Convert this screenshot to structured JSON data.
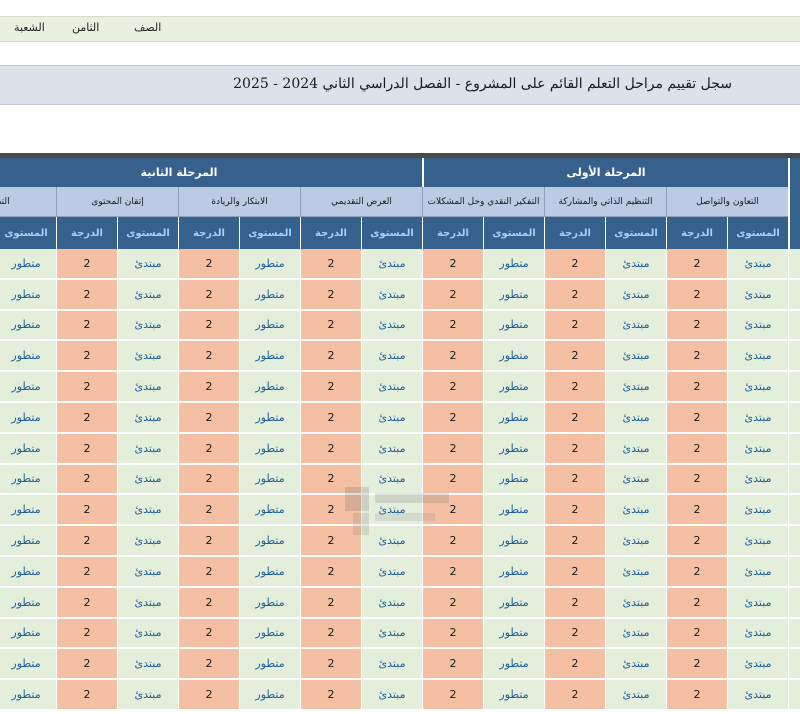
{
  "header": {
    "division_label": "الشعبة",
    "grade_value": "الثامن",
    "grade_label": "الصف"
  },
  "title": "سجل تقييم مراحل التعلم القائم على المشروع - الفصل الدراسي الثاني  2024 - 2025",
  "table": {
    "stages": [
      {
        "label": "المرحلة الأولى",
        "criteria_count": 3
      },
      {
        "label": "المرحلة الثانية",
        "criteria_count": 4
      }
    ],
    "criteria": [
      "التعاون والتواصل",
      "التنظيم الذاتي والمشاركة",
      "التفكير النقدي وحل المشكلات",
      "العرض التقديمي",
      "الابتكار والريادة",
      "إتقان المحتوى",
      "التطبيق"
    ],
    "sub_headers": {
      "level": "المستوى",
      "grade": "الدرجة"
    },
    "criteria_data": [
      {
        "levels": [
          "مبتدئ",
          "مبتدئ",
          "مبتدئ",
          "مبتدئ",
          "مبتدئ",
          "مبتدئ",
          "مبتدئ",
          "مبتدئ",
          "مبتدئ",
          "مبتدئ",
          "مبتدئ",
          "مبتدئ",
          "مبتدئ",
          "مبتدئ",
          "مبتدئ"
        ],
        "grades": [
          "2",
          "2",
          "2",
          "2",
          "2",
          "2",
          "2",
          "2",
          "2",
          "2",
          "2",
          "2",
          "2",
          "2",
          "2"
        ]
      },
      {
        "levels": [
          "مبتدئ",
          "مبتدئ",
          "مبتدئ",
          "مبتدئ",
          "مبتدئ",
          "مبتدئ",
          "مبتدئ",
          "مبتدئ",
          "مبتدئ",
          "مبتدئ",
          "مبتدئ",
          "مبتدئ",
          "مبتدئ",
          "مبتدئ",
          "مبتدئ"
        ],
        "grades": [
          "2",
          "2",
          "2",
          "2",
          "2",
          "2",
          "2",
          "2",
          "2",
          "2",
          "2",
          "2",
          "2",
          "2",
          "2"
        ]
      },
      {
        "levels": [
          "متطور",
          "متطور",
          "متطور",
          "متطور",
          "متطور",
          "متطور",
          "متطور",
          "متطور",
          "متطور",
          "متطور",
          "متطور",
          "متطور",
          "متطور",
          "متطور",
          "متطور"
        ],
        "grades": [
          "2",
          "2",
          "2",
          "2",
          "2",
          "2",
          "2",
          "2",
          "2",
          "2",
          "2",
          "2",
          "2",
          "2",
          "2"
        ]
      },
      {
        "levels": [
          "مبتدئ",
          "مبتدئ",
          "مبتدئ",
          "مبتدئ",
          "مبتدئ",
          "مبتدئ",
          "مبتدئ",
          "مبتدئ",
          "مبتدئ",
          "مبتدئ",
          "مبتدئ",
          "مبتدئ",
          "مبتدئ",
          "مبتدئ",
          "مبتدئ"
        ],
        "grades": [
          "2",
          "2",
          "2",
          "2",
          "2",
          "2",
          "2",
          "2",
          "2",
          "2",
          "2",
          "2",
          "2",
          "2",
          "2"
        ]
      },
      {
        "levels": [
          "متطور",
          "متطور",
          "متطور",
          "متطور",
          "متطور",
          "متطور",
          "متطور",
          "متطور",
          "متطور",
          "متطور",
          "متطور",
          "متطور",
          "متطور",
          "متطور",
          "متطور"
        ],
        "grades": [
          "2",
          "2",
          "2",
          "2",
          "2",
          "2",
          "2",
          "2",
          "2",
          "2",
          "2",
          "2",
          "2",
          "2",
          "2"
        ]
      },
      {
        "levels": [
          "مبتدئ",
          "مبتدئ",
          "مبتدئ",
          "مبتدئ",
          "مبتدئ",
          "مبتدئ",
          "مبتدئ",
          "مبتدئ",
          "مبتدئ",
          "مبتدئ",
          "مبتدئ",
          "مبتدئ",
          "مبتدئ",
          "مبتدئ",
          "مبتدئ"
        ],
        "grades": [
          "2",
          "2",
          "2",
          "2",
          "2",
          "2",
          "2",
          "2",
          "2",
          "2",
          "2",
          "2",
          "2",
          "2",
          "2"
        ]
      },
      {
        "levels": [
          "متطور",
          "متطور",
          "متطور",
          "متطور",
          "متطور",
          "متطور",
          "متطور",
          "متطور",
          "متطور",
          "متطور",
          "متطور",
          "متطور",
          "متطور",
          "متطور",
          "متطور"
        ],
        "grades": []
      }
    ]
  },
  "colors": {
    "header_blue": "#36618c",
    "criteria_blue": "#bccbe3",
    "level_green": "#e3eedb",
    "grade_peach": "#f4bfa3",
    "level_text": "#1f5e99"
  }
}
